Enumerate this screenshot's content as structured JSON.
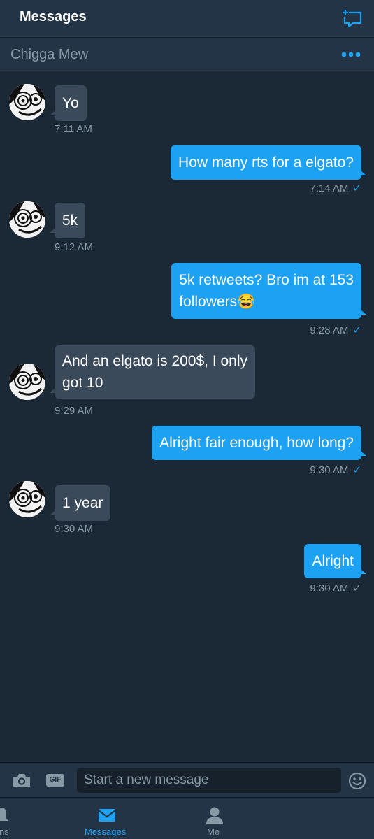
{
  "header": {
    "title": "Messages",
    "compose_icon": "compose-message-icon"
  },
  "conversation": {
    "name": "Chigga Mew",
    "more_icon": "more-options-icon"
  },
  "messages": [
    {
      "direction": "in",
      "text": "Yo",
      "time": "7:11 AM"
    },
    {
      "direction": "out",
      "text": "How many rts for a elgato?",
      "time": "7:14 AM",
      "status": "✓"
    },
    {
      "direction": "in",
      "text": "5k",
      "time": "9:12 AM"
    },
    {
      "direction": "out",
      "lines": [
        "5k retweets? Bro im at 153",
        "followers😂"
      ],
      "time": "9:28 AM",
      "status": "✓"
    },
    {
      "direction": "in",
      "lines": [
        "And an elgato is 200$, I only",
        "got 10"
      ],
      "time": "9:29 AM"
    },
    {
      "direction": "out",
      "text": "Alright fair enough, how long?",
      "time": "9:30 AM",
      "status": "✓"
    },
    {
      "direction": "in",
      "text": "1 year",
      "time": "9:30 AM"
    },
    {
      "direction": "out",
      "text": "Alright",
      "time": "9:30 AM",
      "status": "✓"
    }
  ],
  "composer": {
    "placeholder": "Start a new message",
    "gif_label": "GIF",
    "camera_icon": "camera-icon",
    "emoji_icon": "emoji-icon"
  },
  "tabs": [
    {
      "label": "ations",
      "icon": "notifications-bell-icon",
      "active": false
    },
    {
      "label": "Messages",
      "icon": "envelope-icon",
      "active": true
    },
    {
      "label": "Me",
      "icon": "person-icon",
      "active": false
    }
  ],
  "colors": {
    "accent": "#1da1f2",
    "background": "#1b2835",
    "bar": "#243447",
    "incoming_bubble": "#3a4a5b",
    "muted_text": "#8899a6"
  }
}
